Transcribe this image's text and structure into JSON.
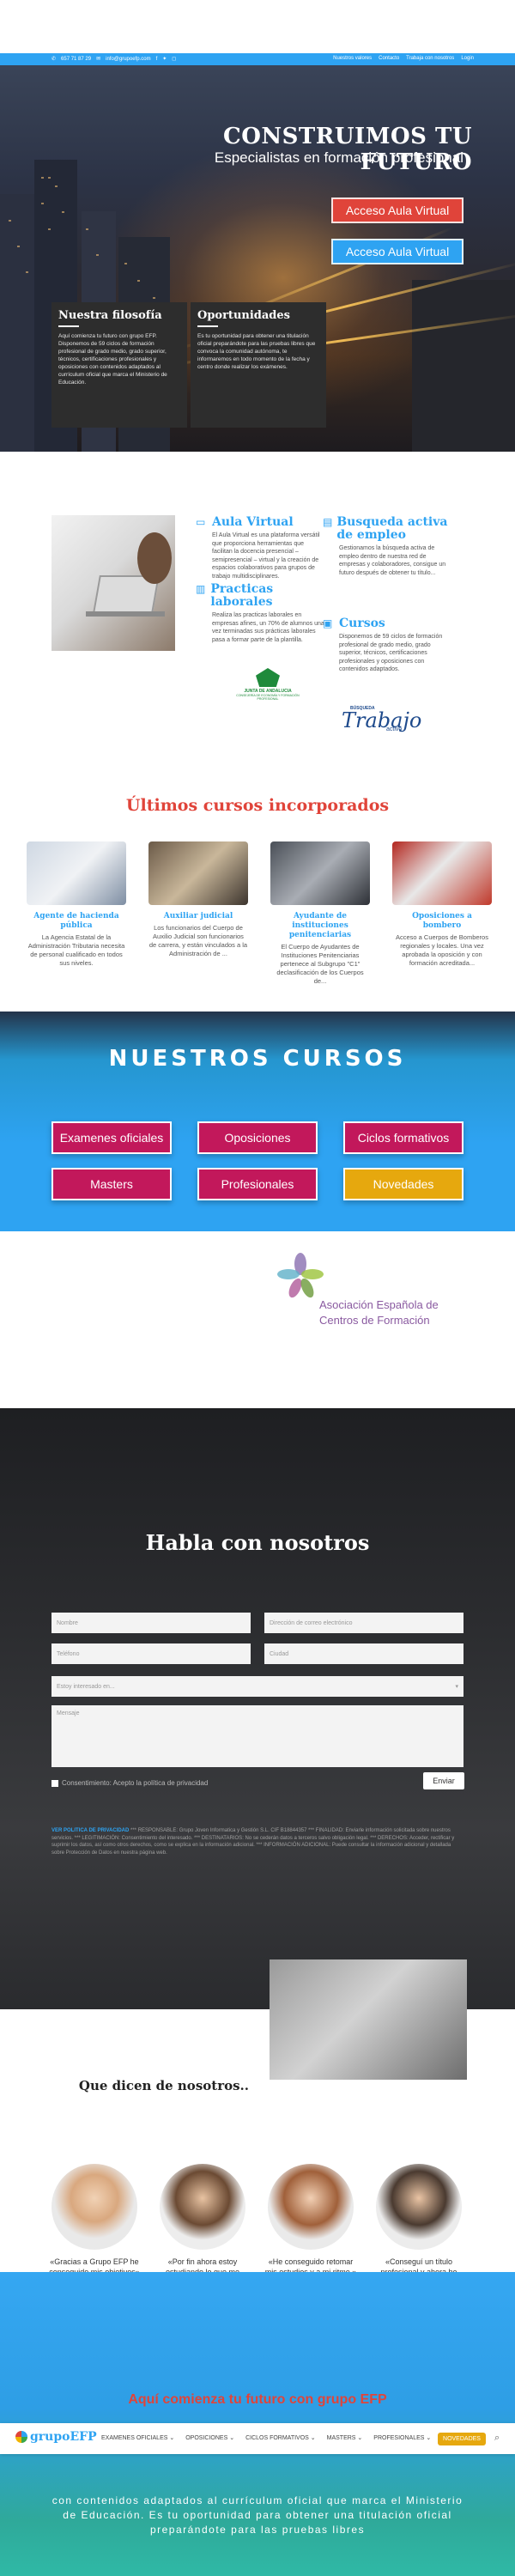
{
  "topbar": {
    "phone": "657 71 87 29",
    "email": "info@grupoefp.com",
    "menu": [
      "Nuestros valores",
      "Contacto",
      "Trabaja con nosotros",
      "Login"
    ]
  },
  "hero": {
    "title": "CONSTRUIMOS TU FUTURO",
    "subtitle": "Especialistas en formación profesional",
    "button_1": "Acceso Aula Virtual",
    "button_2": "Acceso Aula Virtual"
  },
  "cards": {
    "filosofia": {
      "title": "Nuestra filosofía",
      "text": "Aquí comienza tu futuro con grupo EFP. Disponemos de 59 ciclos de formación profesional de grado medio, grado superior, técnicos, certificaciones profesionales y oposiciones con contenidos adaptados al currículum oficial que marca el Ministerio de Educación."
    },
    "oportunidades": {
      "title": "Oportunidades",
      "text": "Es tu oportunidad para obtener una titulación oficial preparándote para las pruebas libres que convoca la comunidad autónoma, te informaremos en todo momento de la fecha y centro donde realizar los exámenes."
    }
  },
  "features": {
    "aula": {
      "title": "Aula Virtual",
      "text": "El Aula Virtual es una plataforma versátil que proporciona herramientas que facilitan la docencia presencial – semipresencial – virtual y la creación de espacios colaborativos para grupos de trabajo multidisciplinares."
    },
    "busqueda": {
      "title": "Busqueda activa de empleo",
      "text": "Gestionamos la búsqueda activa de empleo dentro de nuestra red de empresas y colaboradores, consigue un futuro después de obtener tu título..."
    },
    "practicas": {
      "title": "Practicas laborales",
      "text": "Realiza las practicas laborales en empresas afines, un 70% de alumnos una vez terminadas sus prácticas laborales pasa a formar parte de la plantilla."
    },
    "cursos": {
      "title": "Cursos",
      "text": "Disponemos de 59 ciclos de formación profesional de grado medio, grado superior, técnicos, certificaciones profesionales y oposiciones con contenidos adaptados."
    },
    "logo_junta": "JUNTA DE ANDALUCIA",
    "logo_junta_sub": "CONSEJERÍA DE ECONOMÍA Y FORMACIÓN PROFESIONAL",
    "logo_trabajo_top": "BÚSQUEDA",
    "logo_trabajo_main": "Trabajo",
    "logo_trabajo_sub": "activo"
  },
  "ultimos": {
    "title": "Últimos cursos incorporados",
    "items": [
      {
        "title": "Agente de hacienda pública",
        "text": "La Agencia Estatal de la Administración Tributaria necesita de personal cualificado en todos sus niveles."
      },
      {
        "title": "Auxiliar judicial",
        "text": "Los funcionarios del Cuerpo de Auxilio Judicial son funcionarios de carrera, y están vinculados a la Administración de ..."
      },
      {
        "title": "Ayudante de instituciones penitenciarias",
        "text": "El Cuerpo de Ayudantes de Instituciones Penitenciarias pertenece al Subgrupo \"C1\" declasificación de los Cuerpos de..."
      },
      {
        "title": "Oposiciones a bombero",
        "text": "Acceso a Cuerpos de Bomberos regionales y locales. Una vez aprobada la oposición y con formación acreditada..."
      }
    ]
  },
  "nuestros": {
    "title": "NUESTROS CURSOS",
    "buttons": [
      "Examenes oficiales",
      "Oposiciones",
      "Ciclos formativos",
      "Masters",
      "Profesionales",
      "Novedades"
    ]
  },
  "asociacion": {
    "line1": "Asociación Española de",
    "line2": "Centros de Formación"
  },
  "contact": {
    "title": "Habla con nosotros",
    "ph_name": "Nombre",
    "ph_email": "Dirección de correo electrónico",
    "ph_phone": "Teléfono",
    "ph_city": "Ciudad",
    "ph_select": "Estoy interesado en...",
    "ph_message": "Mensaje",
    "consent": "Consentimiento: Acepto la política de privacidad",
    "send": "Enviar",
    "legal_head": "VER POLITICA DE PRIVACIDAD",
    "legal_text": "*** RESPONSABLE: Grupo Joven Informatica y Gestión S.L. CIF B18844357 *** FINALIDAD: Enviarle información solicitada sobre nuestros servicios. *** LEGITIMACIÓN: Consentimiento del interesado. *** DESTINATARIOS: No se cederán datos a terceros salvo obligación legal. *** DERECHOS: Acceder, rectificar y suprimir los datos, así como otros derechos, como se explica en la información adicional. *** INFORMACIÓN ADICIONAL: Puede consultar la información adicional y detallada sobre Protección de Datos en nuestra página web."
  },
  "testimonials": {
    "title": "Que dicen de nosotros..",
    "quotes": [
      "«Gracias a Grupo EFP he conseguido mis objetivos»",
      "«Por fin ahora estoy estudiando lo que me gusta.»",
      "«He conseguido retomar mis estudios y a mi ritmo.»",
      "«Conseguí un título profesional y ahora he montado y startup.»"
    ]
  },
  "banner": {
    "red_text": "Aquí comienza tu futuro con grupo EFP",
    "white_text": "con contenidos adaptados al currículum oficial que marca el Ministerio de Educación. Es tu oportunidad para obtener una titulación oficial preparándote para las pruebas libres"
  },
  "nav": {
    "logo_text": "grupoEFP",
    "items": [
      "EXAMENES OFICIALES ⌄",
      "OPOSICIONES ⌄",
      "CICLOS FORMATIVOS ⌄",
      "MASTERS ⌄",
      "PROFESIONALES ⌄"
    ],
    "cta": "NOVEDADES"
  },
  "colors": {
    "accent": "#2ea3f2",
    "red": "#e0443a",
    "magenta": "#c2185b",
    "gold": "#e6a80e"
  }
}
